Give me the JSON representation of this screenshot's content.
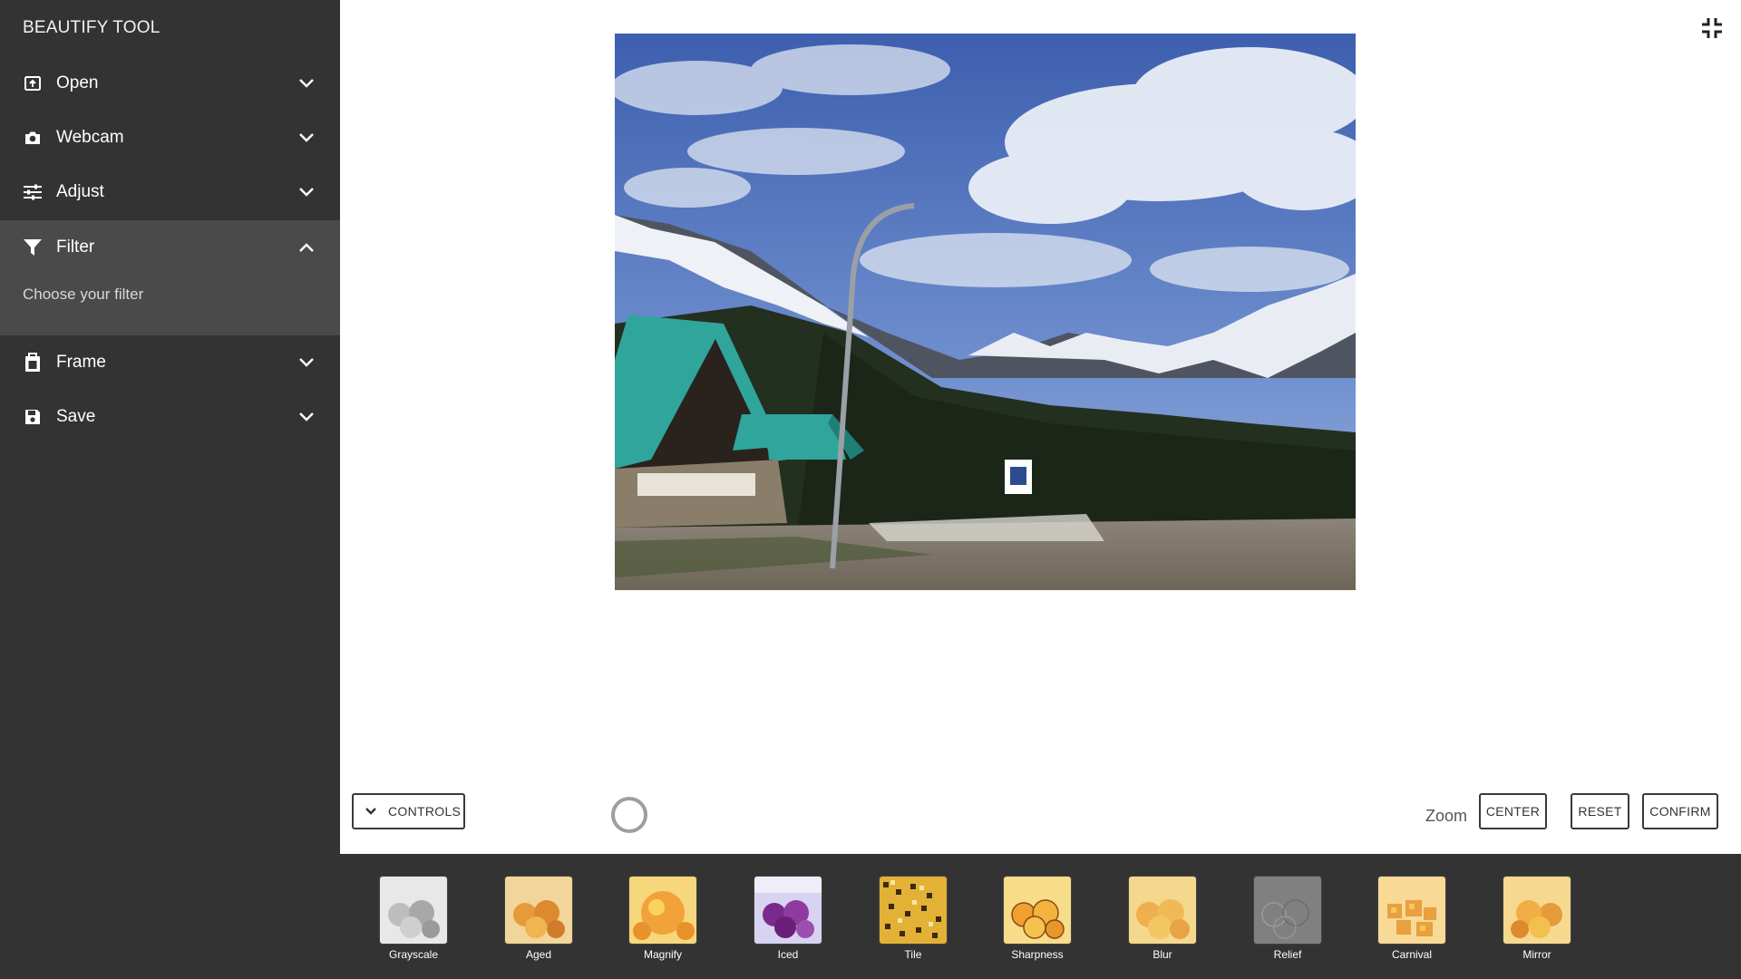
{
  "app": {
    "title": "BEAUTIFY TOOL"
  },
  "sidebar": {
    "items": [
      {
        "label": "Open",
        "icon": "open-icon",
        "expanded": false
      },
      {
        "label": "Webcam",
        "icon": "camera-icon",
        "expanded": false
      },
      {
        "label": "Adjust",
        "icon": "sliders-icon",
        "expanded": false
      },
      {
        "label": "Filter",
        "icon": "filter-icon",
        "expanded": true
      },
      {
        "label": "Frame",
        "icon": "frame-icon",
        "expanded": false
      },
      {
        "label": "Save",
        "icon": "save-icon",
        "expanded": false
      }
    ],
    "filter_hint": "Choose your filter"
  },
  "toolbar": {
    "controls_label": "CONTROLS",
    "zoom_label": "Zoom",
    "center_label": "CENTER",
    "reset_label": "RESET",
    "confirm_label": "CONFIRM"
  },
  "filters": [
    {
      "label": "Grayscale"
    },
    {
      "label": "Aged"
    },
    {
      "label": "Magnify"
    },
    {
      "label": "Iced"
    },
    {
      "label": "Tile"
    },
    {
      "label": "Sharpness"
    },
    {
      "label": "Blur"
    },
    {
      "label": "Relief"
    },
    {
      "label": "Carnival"
    },
    {
      "label": "Mirror"
    }
  ],
  "colors": {
    "sidebar_bg": "#333333",
    "active_bg": "#4a4a4a",
    "roof_teal": "#2fa59c"
  }
}
